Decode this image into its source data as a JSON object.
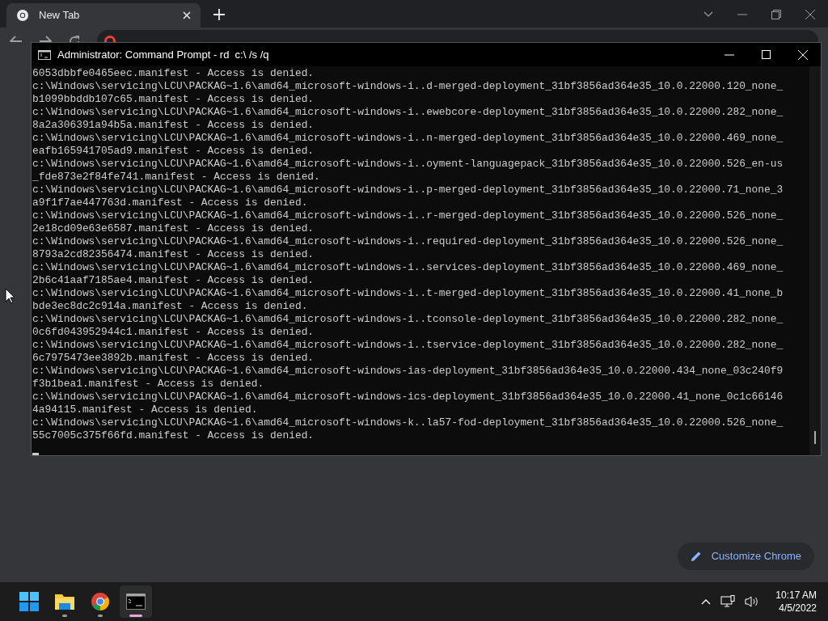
{
  "browser": {
    "tab": {
      "title": "New Tab",
      "selected": true
    },
    "customize_button": "Customize Chrome"
  },
  "console": {
    "title": "Administrator: Command Prompt - rd  c:\\ /s /q",
    "lines": [
      "6053dbbfe0465eec.manifest - Access is denied.",
      "c:\\Windows\\servicing\\LCU\\PACKAG~1.6\\amd64_microsoft-windows-i..d-merged-deployment_31bf3856ad364e35_10.0.22000.120_none_",
      "b1099bbddb107c65.manifest - Access is denied.",
      "c:\\Windows\\servicing\\LCU\\PACKAG~1.6\\amd64_microsoft-windows-i..ewebcore-deployment_31bf3856ad364e35_10.0.22000.282_none_",
      "8a2a306391a94b5a.manifest - Access is denied.",
      "c:\\Windows\\servicing\\LCU\\PACKAG~1.6\\amd64_microsoft-windows-i..n-merged-deployment_31bf3856ad364e35_10.0.22000.469_none_",
      "eafb165941705ad9.manifest - Access is denied.",
      "c:\\Windows\\servicing\\LCU\\PACKAG~1.6\\amd64_microsoft-windows-i..oyment-languagepack_31bf3856ad364e35_10.0.22000.526_en-us",
      "_fde873e2f84fe741.manifest - Access is denied.",
      "c:\\Windows\\servicing\\LCU\\PACKAG~1.6\\amd64_microsoft-windows-i..p-merged-deployment_31bf3856ad364e35_10.0.22000.71_none_3",
      "a9f1f7ae447763d.manifest - Access is denied.",
      "c:\\Windows\\servicing\\LCU\\PACKAG~1.6\\amd64_microsoft-windows-i..r-merged-deployment_31bf3856ad364e35_10.0.22000.526_none_",
      "2e18cd09e63e6587.manifest - Access is denied.",
      "c:\\Windows\\servicing\\LCU\\PACKAG~1.6\\amd64_microsoft-windows-i..required-deployment_31bf3856ad364e35_10.0.22000.526_none_",
      "8793a2cd82356474.manifest - Access is denied.",
      "c:\\Windows\\servicing\\LCU\\PACKAG~1.6\\amd64_microsoft-windows-i..services-deployment_31bf3856ad364e35_10.0.22000.469_none_",
      "2b6c41aaf7185ae4.manifest - Access is denied.",
      "c:\\Windows\\servicing\\LCU\\PACKAG~1.6\\amd64_microsoft-windows-i..t-merged-deployment_31bf3856ad364e35_10.0.22000.41_none_b",
      "bde3ec8dc2c914a.manifest - Access is denied.",
      "c:\\Windows\\servicing\\LCU\\PACKAG~1.6\\amd64_microsoft-windows-i..tconsole-deployment_31bf3856ad364e35_10.0.22000.282_none_",
      "0c6fd043952944c1.manifest - Access is denied.",
      "c:\\Windows\\servicing\\LCU\\PACKAG~1.6\\amd64_microsoft-windows-i..tservice-deployment_31bf3856ad364e35_10.0.22000.282_none_",
      "6c7975473ee3892b.manifest - Access is denied.",
      "c:\\Windows\\servicing\\LCU\\PACKAG~1.6\\amd64_microsoft-windows-ias-deployment_31bf3856ad364e35_10.0.22000.434_none_03c240f9",
      "f3b1bea1.manifest - Access is denied.",
      "c:\\Windows\\servicing\\LCU\\PACKAG~1.6\\amd64_microsoft-windows-ics-deployment_31bf3856ad364e35_10.0.22000.41_none_0c1c66146",
      "4a94115.manifest - Access is denied.",
      "c:\\Windows\\servicing\\LCU\\PACKAG~1.6\\amd64_microsoft-windows-k..la57-fod-deployment_31bf3856ad364e35_10.0.22000.526_none_",
      "55c7005c375f66fd.manifest - Access is denied."
    ]
  },
  "taskbar": {
    "apps": [
      {
        "kind": "start",
        "selected": false
      },
      {
        "kind": "explorer",
        "running": true,
        "selected": false
      },
      {
        "kind": "chrome",
        "running": true,
        "selected": false
      },
      {
        "kind": "terminal",
        "running": true,
        "selected": true
      }
    ],
    "time": "10:17 AM",
    "date": "4/5/2022"
  }
}
